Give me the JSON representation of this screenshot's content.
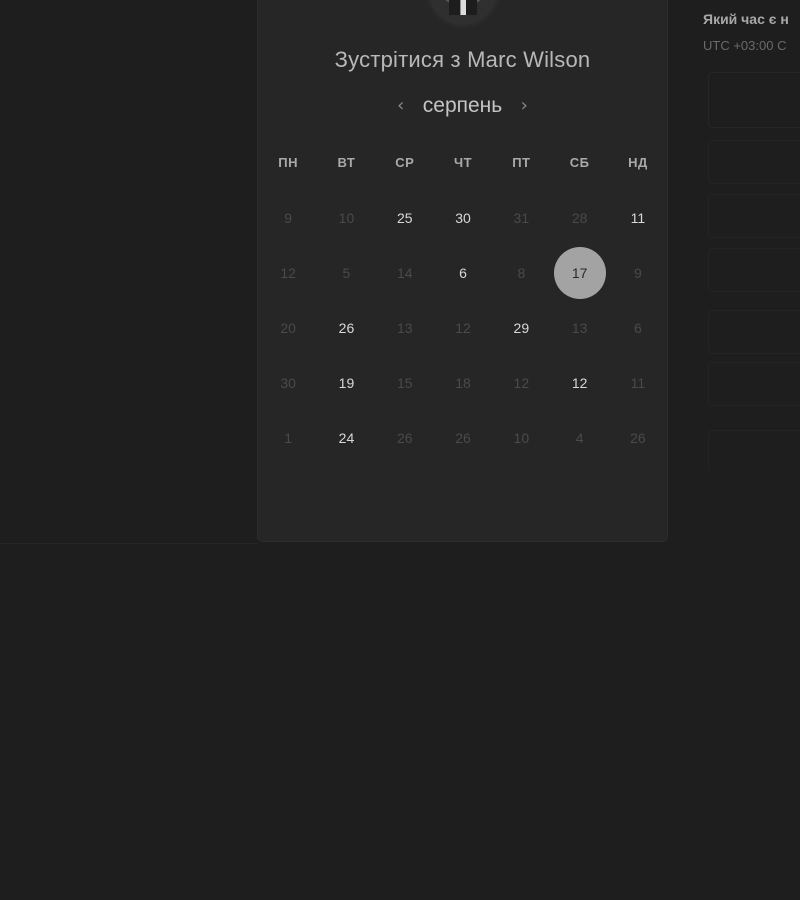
{
  "booking": {
    "title": "Зустрітися з Marc Wilson",
    "month": "серпень",
    "prev_icon": "‹",
    "next_icon": "›",
    "weekdays": [
      "ПН",
      "ВТ",
      "СР",
      "ЧТ",
      "ПТ",
      "СБ",
      "НД"
    ],
    "weeks": [
      [
        {
          "d": "9",
          "a": false
        },
        {
          "d": "10",
          "a": false
        },
        {
          "d": "25",
          "a": true
        },
        {
          "d": "30",
          "a": true
        },
        {
          "d": "31",
          "a": false
        },
        {
          "d": "28",
          "a": false
        },
        {
          "d": "11",
          "a": true
        }
      ],
      [
        {
          "d": "12",
          "a": false
        },
        {
          "d": "5",
          "a": false
        },
        {
          "d": "14",
          "a": false
        },
        {
          "d": "6",
          "a": true
        },
        {
          "d": "8",
          "a": false
        },
        {
          "d": "17",
          "a": true,
          "selected": true
        },
        {
          "d": "9",
          "a": false
        }
      ],
      [
        {
          "d": "20",
          "a": false
        },
        {
          "d": "26",
          "a": true
        },
        {
          "d": "13",
          "a": false
        },
        {
          "d": "12",
          "a": false
        },
        {
          "d": "29",
          "a": true
        },
        {
          "d": "13",
          "a": false
        },
        {
          "d": "6",
          "a": false
        }
      ],
      [
        {
          "d": "30",
          "a": false
        },
        {
          "d": "19",
          "a": true
        },
        {
          "d": "15",
          "a": false
        },
        {
          "d": "18",
          "a": false
        },
        {
          "d": "12",
          "a": false
        },
        {
          "d": "12",
          "a": true
        },
        {
          "d": "11",
          "a": false
        }
      ],
      [
        {
          "d": "1",
          "a": false
        },
        {
          "d": "24",
          "a": true
        },
        {
          "d": "26",
          "a": false
        },
        {
          "d": "26",
          "a": false
        },
        {
          "d": "10",
          "a": false
        },
        {
          "d": "4",
          "a": false
        },
        {
          "d": "26",
          "a": false
        }
      ]
    ]
  },
  "timezone": {
    "title": "Який час є н",
    "subtitle": "UTC +03:00 С"
  },
  "colors": {
    "background": "#1e1e1e",
    "card": "#262626",
    "selected": "#a3a3a3"
  }
}
